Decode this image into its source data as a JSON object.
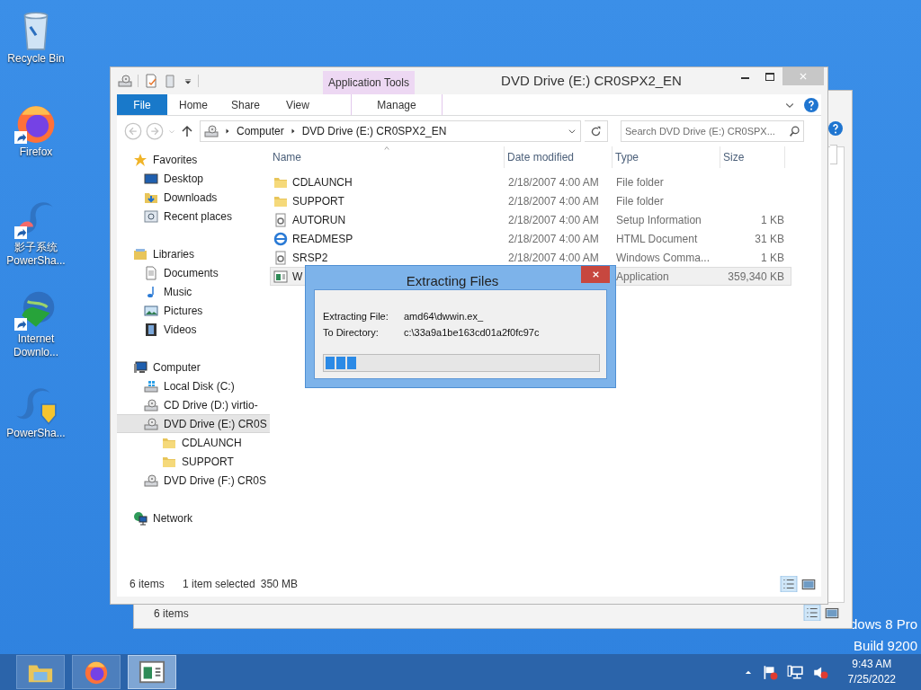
{
  "desktop_icons": [
    {
      "kind": "bin",
      "lines": [
        "Recycle Bin"
      ],
      "shortcut": false
    },
    {
      "kind": "firefox",
      "lines": [
        "Firefox"
      ],
      "shortcut": true
    },
    {
      "kind": "swirl",
      "lines": [
        "影子系统",
        "PowerSha..."
      ],
      "shortcut": true
    },
    {
      "kind": "globe",
      "lines": [
        "Internet",
        "Downlo..."
      ],
      "shortcut": true
    },
    {
      "kind": "shield",
      "lines": [
        "PowerSha..."
      ],
      "shortcut": false
    }
  ],
  "desktop_text": [
    "dows 8 Pro",
    "Build 9200"
  ],
  "back_window": {
    "status": "6 items"
  },
  "explorer": {
    "title": "DVD Drive (E:) CR0SPX2_EN",
    "contextual_tab": "Application Tools",
    "tabs": [
      {
        "label": "File",
        "kind": "file"
      },
      {
        "label": "Home",
        "kind": "tab"
      },
      {
        "label": "Share",
        "kind": "tab"
      },
      {
        "label": "View",
        "kind": "tab"
      },
      {
        "label": "Manage",
        "kind": "contextual"
      }
    ],
    "address": {
      "crumbs": [
        "Computer",
        "DVD Drive (E:) CR0SPX2_EN"
      ]
    },
    "search": {
      "placeholder": "Search DVD Drive (E:) CR0SPX..."
    },
    "nav": [
      {
        "label": "Favorites",
        "kind": "star",
        "selected": false,
        "children": [
          {
            "label": "Desktop",
            "kind": "desktop",
            "selected": false
          },
          {
            "label": "Downloads",
            "kind": "downloads",
            "selected": false
          },
          {
            "label": "Recent places",
            "kind": "recent",
            "selected": false
          }
        ]
      },
      {
        "label": "Libraries",
        "kind": "library",
        "selected": false,
        "children": [
          {
            "label": "Documents",
            "kind": "document",
            "selected": false
          },
          {
            "label": "Music",
            "kind": "music",
            "selected": false
          },
          {
            "label": "Pictures",
            "kind": "pictures",
            "selected": false
          },
          {
            "label": "Videos",
            "kind": "videos",
            "selected": false
          }
        ]
      },
      {
        "label": "Computer",
        "kind": "computer",
        "selected": false,
        "children": [
          {
            "label": "Local Disk (C:)",
            "kind": "disk",
            "selected": false
          },
          {
            "label": "CD Drive (D:) virtio-",
            "kind": "drive",
            "selected": false
          },
          {
            "label": "DVD Drive (E:) CR0S",
            "kind": "drive",
            "selected": true,
            "children": [
              {
                "label": "CDLAUNCH",
                "kind": "folder",
                "selected": false
              },
              {
                "label": "SUPPORT",
                "kind": "folder",
                "selected": false
              }
            ]
          },
          {
            "label": "DVD Drive (F:) CR0S",
            "kind": "drive",
            "selected": false
          }
        ]
      },
      {
        "label": "Network",
        "kind": "network",
        "selected": false
      }
    ],
    "columns": [
      "Name",
      "Date modified",
      "Type",
      "Size"
    ],
    "rows": [
      {
        "kind": "folder",
        "name": "CDLAUNCH",
        "date": "2/18/2007 4:00 AM",
        "type": "File folder",
        "selected": false
      },
      {
        "kind": "folder",
        "name": "SUPPORT",
        "date": "2/18/2007 4:00 AM",
        "type": "File folder",
        "selected": false
      },
      {
        "kind": "setup",
        "name": "AUTORUN",
        "date": "2/18/2007 4:00 AM",
        "type": "Setup Information",
        "size": "1 KB",
        "selected": false
      },
      {
        "kind": "html",
        "name": "READMESP",
        "date": "2/18/2007 4:00 AM",
        "type": "HTML Document",
        "size": "31 KB",
        "selected": false
      },
      {
        "kind": "setup",
        "name": "SRSP2",
        "date": "2/18/2007 4:00 AM",
        "type": "Windows Comma...",
        "size": "1 KB",
        "selected": false
      },
      {
        "kind": "app",
        "name": "W",
        "type": "Application",
        "size": "359,340 KB",
        "selected": true
      }
    ],
    "status": {
      "count": "6 items",
      "selection": "1 item selected",
      "size": "350 MB"
    }
  },
  "dialog": {
    "title": "Extracting Files",
    "fields": [
      {
        "label": "Extracting File:",
        "value": "amd64\\dwwin.ex_"
      },
      {
        "label": "To Directory:",
        "value": "c:\\33a9a1be163cd01a2f0fc97c"
      }
    ],
    "progress": {
      "level": 0.12
    }
  },
  "taskbar": {
    "items": [
      {
        "kind": "explorer",
        "selected": false
      },
      {
        "kind": "firefox",
        "selected": false
      },
      {
        "kind": "app",
        "selected": true
      }
    ],
    "time": "9:43 AM",
    "date": "7/25/2022"
  }
}
